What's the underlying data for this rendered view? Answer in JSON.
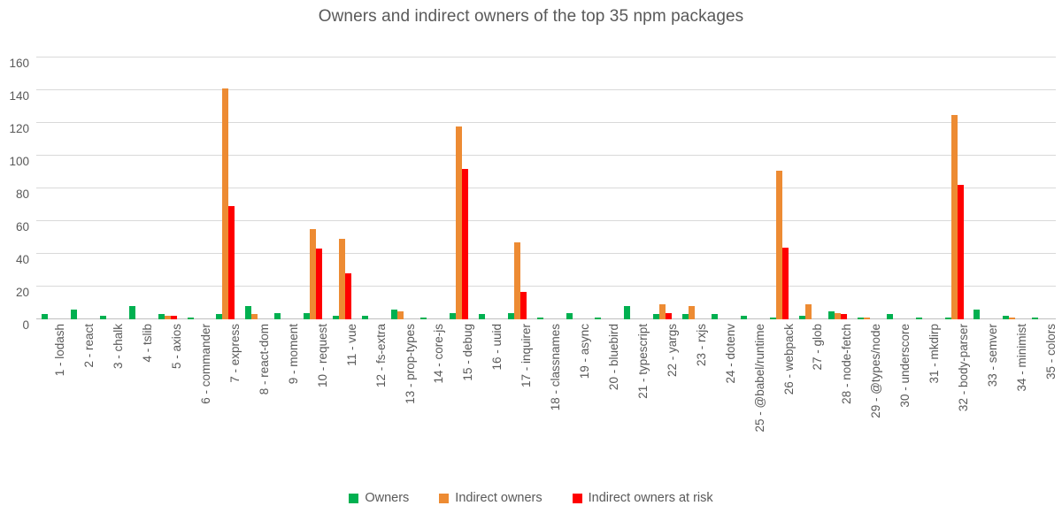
{
  "chart_data": {
    "type": "bar",
    "title": "Owners and indirect owners of the top 35 npm packages",
    "xlabel": "",
    "ylabel": "",
    "ylim": [
      0,
      160
    ],
    "yticks": [
      0,
      20,
      40,
      60,
      80,
      100,
      120,
      140,
      160
    ],
    "grid": true,
    "legend_position": "bottom",
    "categories": [
      "1 - lodash",
      "2 - react",
      "3 - chalk",
      "4 - tslib",
      "5 - axios",
      "6 - commander",
      "7 - express",
      "8 - react-dom",
      "9 - moment",
      "10 - request",
      "11 - vue",
      "12 - fs-extra",
      "13 - prop-types",
      "14 - core-js",
      "15 - debug",
      "16 - uuid",
      "17 - inquirer",
      "18 - classnames",
      "19 - async",
      "20 - bluebird",
      "21 - typescript",
      "22 - yargs",
      "23 - rxjs",
      "24 - dotenv",
      "25 - @babel/runtime",
      "26 - webpack",
      "27 - glob",
      "28 - node-fetch",
      "29 - @types/node",
      "30 - underscore",
      "31 - mkdirp",
      "32 - body-parser",
      "33 - semver",
      "34 - minimist",
      "35 - colors"
    ],
    "series": [
      {
        "name": "Owners",
        "color": "#00b050",
        "values": [
          3,
          6,
          2,
          8,
          3,
          1,
          3,
          8,
          4,
          4,
          2,
          2,
          6,
          1,
          4,
          3,
          4,
          1,
          4,
          1,
          8,
          3,
          3,
          3,
          2,
          1,
          2,
          5,
          1,
          3,
          1,
          1,
          6,
          2,
          1
        ]
      },
      {
        "name": "Indirect owners",
        "color": "#ed8b33",
        "values": [
          0,
          0,
          0,
          0,
          2,
          0,
          141,
          3,
          0,
          55,
          49,
          0,
          5,
          0,
          118,
          0,
          47,
          0,
          0,
          0,
          0,
          9,
          8,
          0,
          0,
          91,
          9,
          4,
          1,
          0,
          0,
          125,
          0,
          1,
          0
        ]
      },
      {
        "name": "Indirect owners at risk",
        "color": "#ff0000",
        "values": [
          0,
          0,
          0,
          0,
          2,
          0,
          69,
          0,
          0,
          43,
          28,
          0,
          0,
          0,
          92,
          0,
          17,
          0,
          0,
          0,
          0,
          4,
          0,
          0,
          0,
          44,
          0,
          3,
          0,
          0,
          0,
          82,
          0,
          0,
          0
        ]
      }
    ]
  },
  "legend": {
    "items": [
      {
        "label": "Owners",
        "color": "#00b050"
      },
      {
        "label": "Indirect owners",
        "color": "#ed8b33"
      },
      {
        "label": "Indirect owners at risk",
        "color": "#ff0000"
      }
    ]
  }
}
